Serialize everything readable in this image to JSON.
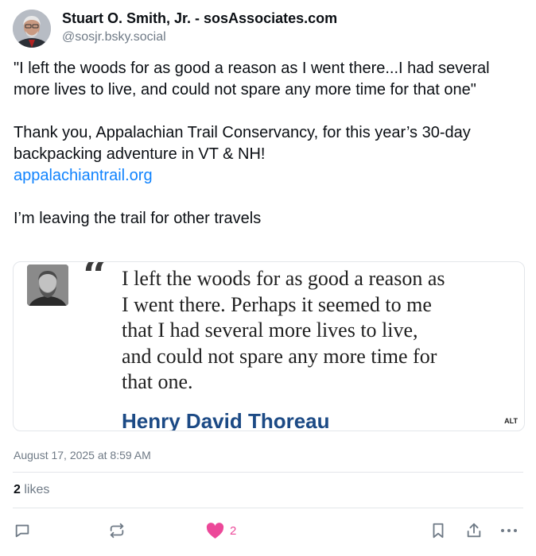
{
  "author": {
    "display_name": "Stuart O. Smith, Jr. - sosAssociates.com",
    "handle": "@sosjr.bsky.social"
  },
  "post": {
    "quote_line": "\"I left the woods for as good a reason as I went there...I had several more lives to live, and could not spare any more time for that one\"",
    "thanks_line": "Thank you, Appalachian Trail Conservancy, for this year’s 30-day backpacking adventure in VT & NH!",
    "link": "appalachiantrail.org",
    "closing_line": "I’m leaving the trail for other travels"
  },
  "embed": {
    "quote_mark": "“",
    "quote_lines": [
      "I left the woods for as good a reason as",
      "I went there. Perhaps it seemed to me",
      "that I had several more lives to live,",
      "and could not spare any more time for",
      "that one."
    ],
    "author": "Henry David Thoreau",
    "alt_badge": "ALT"
  },
  "meta": {
    "timestamp": "August 17, 2025 at 8:59 AM",
    "likes_count": "2",
    "likes_label": " likes"
  },
  "actions": {
    "reply_icon": "reply-icon",
    "repost_icon": "repost-icon",
    "like_icon": "heart-icon",
    "like_count": "2",
    "bookmark_icon": "bookmark-icon",
    "share_icon": "share-icon",
    "more_icon": "more-icon"
  },
  "colors": {
    "link": "#1083fe",
    "like": "#ec4899",
    "muted": "#6f7a86",
    "quote_author": "#1c4a85"
  }
}
